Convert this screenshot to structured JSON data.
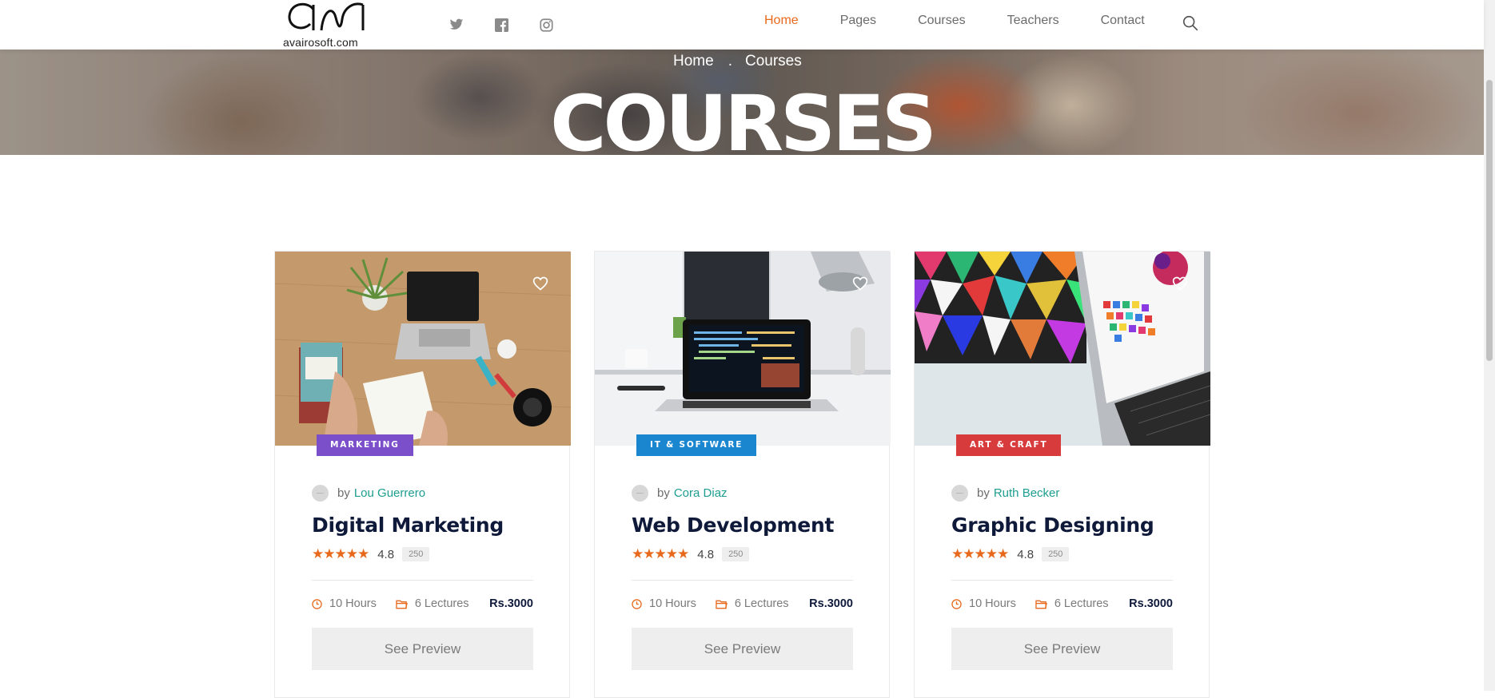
{
  "header": {
    "logo_text": "avairosoft.com",
    "social": [
      "twitter-icon",
      "facebook-icon",
      "instagram-icon"
    ],
    "nav": [
      {
        "label": "Home",
        "active": true
      },
      {
        "label": "Pages",
        "active": false
      },
      {
        "label": "Courses",
        "active": false
      },
      {
        "label": "Teachers",
        "active": false
      },
      {
        "label": "Contact",
        "active": false
      }
    ],
    "search_icon": "search-icon"
  },
  "hero": {
    "breadcrumb_home": "Home",
    "breadcrumb_sep": ".",
    "breadcrumb_current": "Courses",
    "title": "COURSES"
  },
  "colors": {
    "accent": "#e8691c",
    "author_link": "#1d9d8f",
    "heading": "#0f1a3a"
  },
  "courses": [
    {
      "category": "MARKETING",
      "category_color": "#7b4fc9",
      "author_prefix": "by",
      "author": "Lou Guerrero",
      "title": "Digital Marketing",
      "stars": "★★★★★",
      "rating": "4.8",
      "reviews": "250",
      "hours": "10 Hours",
      "lectures": "6 Lectures",
      "price": "Rs.3000",
      "button": "See Preview"
    },
    {
      "category": "IT & SOFTWARE",
      "category_color": "#1b86d0",
      "author_prefix": "by",
      "author": "Cora Diaz",
      "title": "Web Development",
      "stars": "★★★★★",
      "rating": "4.8",
      "reviews": "250",
      "hours": "10 Hours",
      "lectures": "6 Lectures",
      "price": "Rs.3000",
      "button": "See Preview"
    },
    {
      "category": "ART & CRAFT",
      "category_color": "#d73b3b",
      "author_prefix": "by",
      "author": "Ruth Becker",
      "title": "Graphic Designing",
      "stars": "★★★★★",
      "rating": "4.8",
      "reviews": "250",
      "hours": "10 Hours",
      "lectures": "6 Lectures",
      "price": "Rs.3000",
      "button": "See Preview"
    }
  ]
}
